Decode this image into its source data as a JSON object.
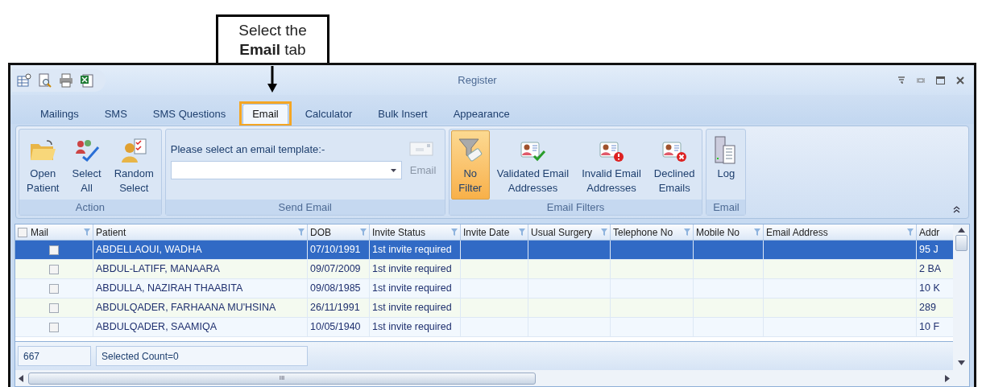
{
  "callout": {
    "text": "Select the **Email** tab"
  },
  "window": {
    "title": "Register"
  },
  "tabs": [
    {
      "label": "Mailings",
      "selected": false,
      "highlighted": false
    },
    {
      "label": "SMS",
      "selected": false,
      "highlighted": false
    },
    {
      "label": "SMS Questions",
      "selected": false,
      "highlighted": false
    },
    {
      "label": "Email",
      "selected": true,
      "highlighted": true
    },
    {
      "label": "Calculator",
      "selected": false,
      "highlighted": false
    },
    {
      "label": "Bulk Insert",
      "selected": false,
      "highlighted": false
    },
    {
      "label": "Appearance",
      "selected": false,
      "highlighted": false
    }
  ],
  "ribbon": [
    {
      "title": "Action",
      "items": [
        {
          "kind": "button",
          "label": "Open\nPatient",
          "selected": false
        },
        {
          "kind": "button",
          "label": "Select\nAll",
          "selected": false
        },
        {
          "kind": "button",
          "label": "Random\nSelect",
          "selected": false
        }
      ]
    },
    {
      "title": "Send Email",
      "items": [
        {
          "kind": "template",
          "prompt": "Please select an email template:-",
          "button": "Email",
          "disabled": true
        }
      ]
    },
    {
      "title": "Email Filters",
      "items": [
        {
          "kind": "button",
          "label": "No\nFilter",
          "selected": true
        },
        {
          "kind": "button",
          "label": "Validated Email\nAddresses",
          "selected": false
        },
        {
          "kind": "button",
          "label": "Invalid Email\nAddresses",
          "selected": false
        },
        {
          "kind": "button",
          "label": "Declined\nEmails",
          "selected": false
        }
      ]
    },
    {
      "title": "Email",
      "items": [
        {
          "kind": "button",
          "label": "Log",
          "selected": false
        }
      ]
    }
  ],
  "table": {
    "header_checked": false,
    "columns": [
      "Mail",
      "Patient",
      "DOB",
      "Invite Status",
      "Invite Date",
      "Usual Surgery",
      "Telephone No",
      "Mobile No",
      "Email Address",
      "Addr"
    ],
    "rows": [
      {
        "selected": true,
        "checked": false,
        "cells": [
          "",
          "ABDELLAOUI, WADHA",
          "07/10/1991",
          "1st invite required",
          "",
          "",
          "",
          "",
          "",
          "95 J"
        ]
      },
      {
        "selected": false,
        "checked": false,
        "cells": [
          "",
          "ABDUL-LATIFF, MANAARA",
          "09/07/2009",
          "1st invite required",
          "",
          "",
          "",
          "",
          "",
          "2 BA"
        ]
      },
      {
        "selected": false,
        "checked": false,
        "cells": [
          "",
          "ABDULLA, NAZIRAH THAABITA",
          "09/08/1985",
          "1st invite required",
          "",
          "",
          "",
          "",
          "",
          "10 K"
        ]
      },
      {
        "selected": false,
        "checked": false,
        "cells": [
          "",
          "ABDULQADER, FARHAANA MU'HSINA",
          "26/11/1991",
          "1st invite required",
          "",
          "",
          "",
          "",
          "",
          "289"
        ]
      },
      {
        "selected": false,
        "checked": false,
        "cells": [
          "",
          "ABDULQADER, SAAMIQA",
          "10/05/1940",
          "1st invite required",
          "",
          "",
          "",
          "",
          "",
          "10 F"
        ]
      }
    ]
  },
  "footer": {
    "count": "667",
    "selected_count": "Selected Count=0"
  },
  "scrollbar": {
    "thumb_label": "III"
  }
}
